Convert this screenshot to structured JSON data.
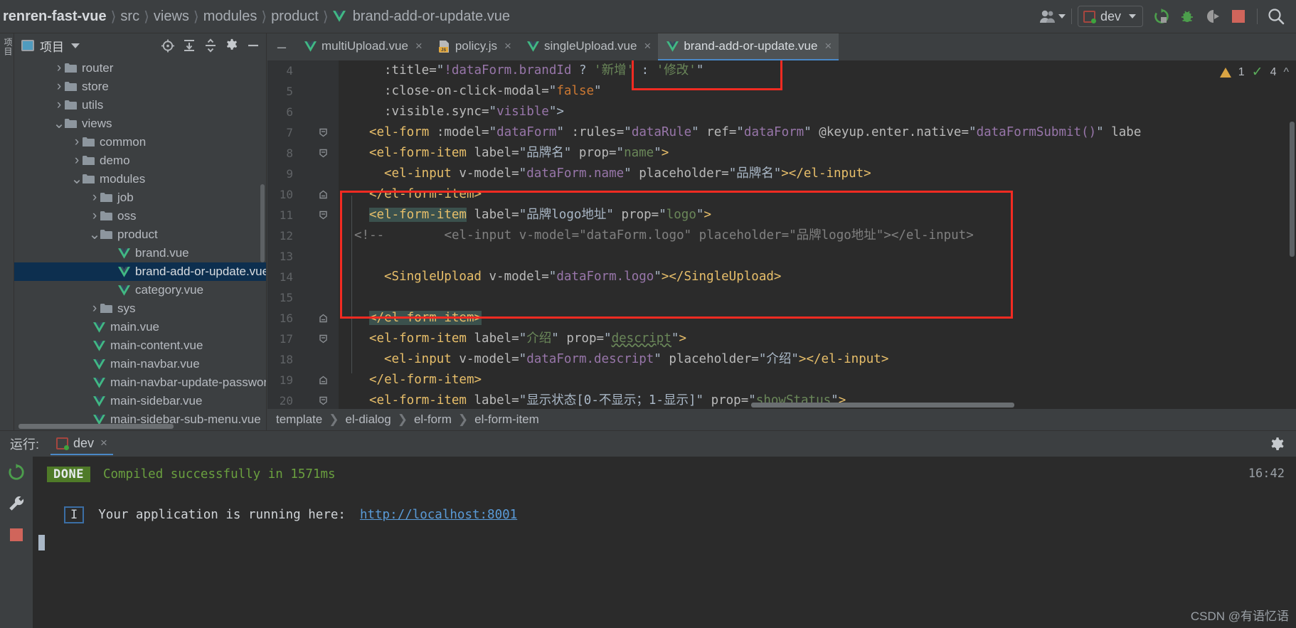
{
  "topbar": {
    "breadcrumb": [
      "renren-fast-vue",
      "src",
      "views",
      "modules",
      "product",
      "brand-add-or-update.vue"
    ],
    "profile_icon": "user-group-icon",
    "run_config": "dev",
    "icons": [
      "rerun-icon",
      "debug-icon",
      "attach-profiler-icon",
      "stop-icon",
      "search-icon"
    ]
  },
  "project_panel": {
    "title": "项目",
    "tool_icons": [
      "locate-icon",
      "expand-all-icon",
      "collapse-all-icon",
      "settings-icon",
      "hide-icon"
    ],
    "tree": [
      {
        "label": "router",
        "type": "folder",
        "arrow": "collapsed",
        "indent": 1
      },
      {
        "label": "store",
        "type": "folder",
        "arrow": "collapsed",
        "indent": 1
      },
      {
        "label": "utils",
        "type": "folder",
        "arrow": "collapsed",
        "indent": 1
      },
      {
        "label": "views",
        "type": "folder",
        "arrow": "expanded",
        "indent": 1
      },
      {
        "label": "common",
        "type": "folder",
        "arrow": "collapsed",
        "indent": 2
      },
      {
        "label": "demo",
        "type": "folder",
        "arrow": "collapsed",
        "indent": 2
      },
      {
        "label": "modules",
        "type": "folder",
        "arrow": "expanded",
        "indent": 2
      },
      {
        "label": "job",
        "type": "folder",
        "arrow": "collapsed",
        "indent": 3
      },
      {
        "label": "oss",
        "type": "folder",
        "arrow": "collapsed",
        "indent": 3
      },
      {
        "label": "product",
        "type": "folder",
        "arrow": "expanded",
        "indent": 3
      },
      {
        "label": "brand.vue",
        "type": "vue",
        "arrow": "none",
        "indent": 4
      },
      {
        "label": "brand-add-or-update.vue",
        "type": "vue",
        "arrow": "none",
        "indent": 4,
        "selected": true
      },
      {
        "label": "category.vue",
        "type": "vue",
        "arrow": "none",
        "indent": 4
      },
      {
        "label": "sys",
        "type": "folder",
        "arrow": "collapsed",
        "indent": 3
      },
      {
        "label": "main.vue",
        "type": "vue",
        "arrow": "none",
        "indent": 2.6
      },
      {
        "label": "main-content.vue",
        "type": "vue",
        "arrow": "none",
        "indent": 2.6
      },
      {
        "label": "main-navbar.vue",
        "type": "vue",
        "arrow": "none",
        "indent": 2.6
      },
      {
        "label": "main-navbar-update-password.",
        "type": "vue",
        "arrow": "none",
        "indent": 2.6
      },
      {
        "label": "main-sidebar.vue",
        "type": "vue",
        "arrow": "none",
        "indent": 2.6
      },
      {
        "label": "main-sidebar-sub-menu.vue",
        "type": "vue",
        "arrow": "none",
        "indent": 2.6
      }
    ]
  },
  "editor": {
    "tabs": [
      {
        "label": "multiUpload.vue",
        "icon": "vue-icon",
        "active": false
      },
      {
        "label": "policy.js",
        "icon": "js-icon",
        "active": false
      },
      {
        "label": "singleUpload.vue",
        "icon": "vue-icon",
        "active": false
      },
      {
        "label": "brand-add-or-update.vue",
        "icon": "vue-icon",
        "active": true
      }
    ],
    "inspection": {
      "warnings": "1",
      "checks": "4"
    },
    "lines": [
      {
        "num": "4",
        "fold": false,
        "highlight": false
      },
      {
        "num": "5",
        "fold": false,
        "highlight": false
      },
      {
        "num": "6",
        "fold": false,
        "highlight": false
      },
      {
        "num": "7",
        "fold": true,
        "highlight": false
      },
      {
        "num": "8",
        "fold": true,
        "highlight": false
      },
      {
        "num": "9",
        "fold": false,
        "highlight": false
      },
      {
        "num": "10",
        "fold": "end",
        "highlight": false
      },
      {
        "num": "11",
        "fold": true,
        "highlight": false
      },
      {
        "num": "12",
        "fold": false,
        "highlight": false
      },
      {
        "num": "13",
        "fold": false,
        "highlight": false
      },
      {
        "num": "14",
        "fold": false,
        "highlight": false
      },
      {
        "num": "15",
        "fold": false,
        "highlight": false
      },
      {
        "num": "16",
        "fold": "end",
        "highlight": false
      },
      {
        "num": "17",
        "fold": true,
        "highlight": false
      },
      {
        "num": "18",
        "fold": false,
        "highlight": false
      },
      {
        "num": "19",
        "fold": "end",
        "highlight": false
      },
      {
        "num": "20",
        "fold": true,
        "highlight": false
      }
    ],
    "code_text": {
      "l4": ":title=\"!dataForm.brandId ? '新增' : '修改'\"",
      "l5": ":close-on-click-modal=\"false\"",
      "l6": ":visible.sync=\"visible\">",
      "l7": "<el-form :model=\"dataForm\" :rules=\"dataRule\" ref=\"dataForm\" @keyup.enter.native=\"dataFormSubmit()\" labe",
      "l8": "<el-form-item label=\"品牌名\" prop=\"name\">",
      "l9": "<el-input v-model=\"dataForm.name\" placeholder=\"品牌名\"></el-input>",
      "l10": "</el-form-item>",
      "l11": "<el-form-item label=\"品牌logo地址\" prop=\"logo\">",
      "l12": "<!--        <el-input v-model=\"dataForm.logo\" placeholder=\"品牌logo地址\"></el-input>-->",
      "l13": "",
      "l14": "<SingleUpload v-model=\"dataForm.logo\"></SingleUpload>",
      "l15": "",
      "l16": "</el-form-item>",
      "l17": "<el-form-item label=\"介绍\" prop=\"descript\">",
      "l18": "<el-input v-model=\"dataForm.descript\" placeholder=\"介绍\"></el-input>",
      "l19": "</el-form-item>",
      "l20": "<el-form-item label=\"显示状态[0-不显示；1-显示]\" prop=\"showStatus\">"
    },
    "breadcrumb": [
      "template",
      "el-dialog",
      "el-form",
      "el-form-item"
    ]
  },
  "run_panel": {
    "label": "运行:",
    "tab_label": "dev",
    "tab_close": "×",
    "gear_icon": "settings-icon",
    "side_icons": [
      "rerun-icon",
      "wrench-icon",
      "stop-icon"
    ],
    "console": {
      "status_badge": "DONE",
      "compiled_msg": "Compiled successfully in 1571ms",
      "timestamp": "16:42",
      "info_badge": "I",
      "app_msg": "Your application is running here:",
      "url": "http://localhost:8001"
    }
  },
  "watermark": "CSDN @有语忆语",
  "colors": {
    "accent_blue": "#4a88c7",
    "vue_green": "#41b883",
    "highlight_red": "#f22b22",
    "selection_blue": "#0d2f4f",
    "editor_bg": "#2b2b2b",
    "panel_bg": "#3c3f41"
  }
}
